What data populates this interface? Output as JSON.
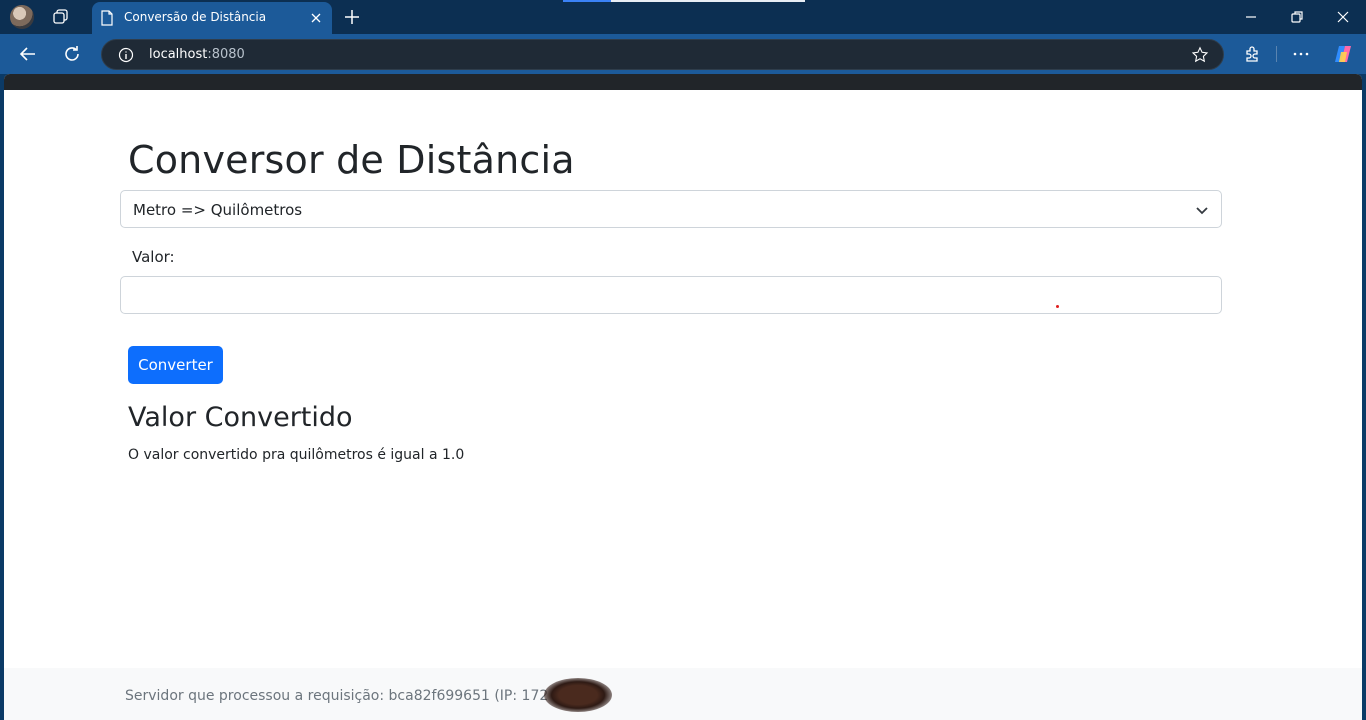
{
  "browser": {
    "tab": {
      "title": "Conversão de Distância"
    },
    "address_bar": {
      "host": "localhost",
      "port": ":8080"
    },
    "icons": [
      "profile-avatar",
      "workspaces-icon",
      "page-icon",
      "close-icon",
      "plus-icon",
      "minimize-icon",
      "restore-icon",
      "close-window-icon",
      "back-icon",
      "refresh-icon",
      "info-icon",
      "star-icon",
      "extensions-icon",
      "more-icon",
      "copilot-icon"
    ],
    "colors": {
      "titlebar": "#0c2f52",
      "toolbar": "#1c5a99",
      "omnibox": "#1f2a36"
    }
  },
  "page": {
    "title": "Conversor de Distância",
    "select": {
      "selected_option": "Metro => Quilômetros"
    },
    "value_label": "Valor:",
    "value_input": {
      "value": "",
      "placeholder": ""
    },
    "convert_button": "Converter",
    "result_heading": "Valor Convertido",
    "result_text": "O valor convertido pra quilômetros é igual a 1.0",
    "footer_text": "Servidor que processou a requisição: bca82f699651 (IP: 172",
    "colors": {
      "primary_button": "#0d6efd",
      "navbar": "#212529",
      "footer_bg": "#f8f9fa",
      "footer_text": "#6c757d"
    }
  }
}
